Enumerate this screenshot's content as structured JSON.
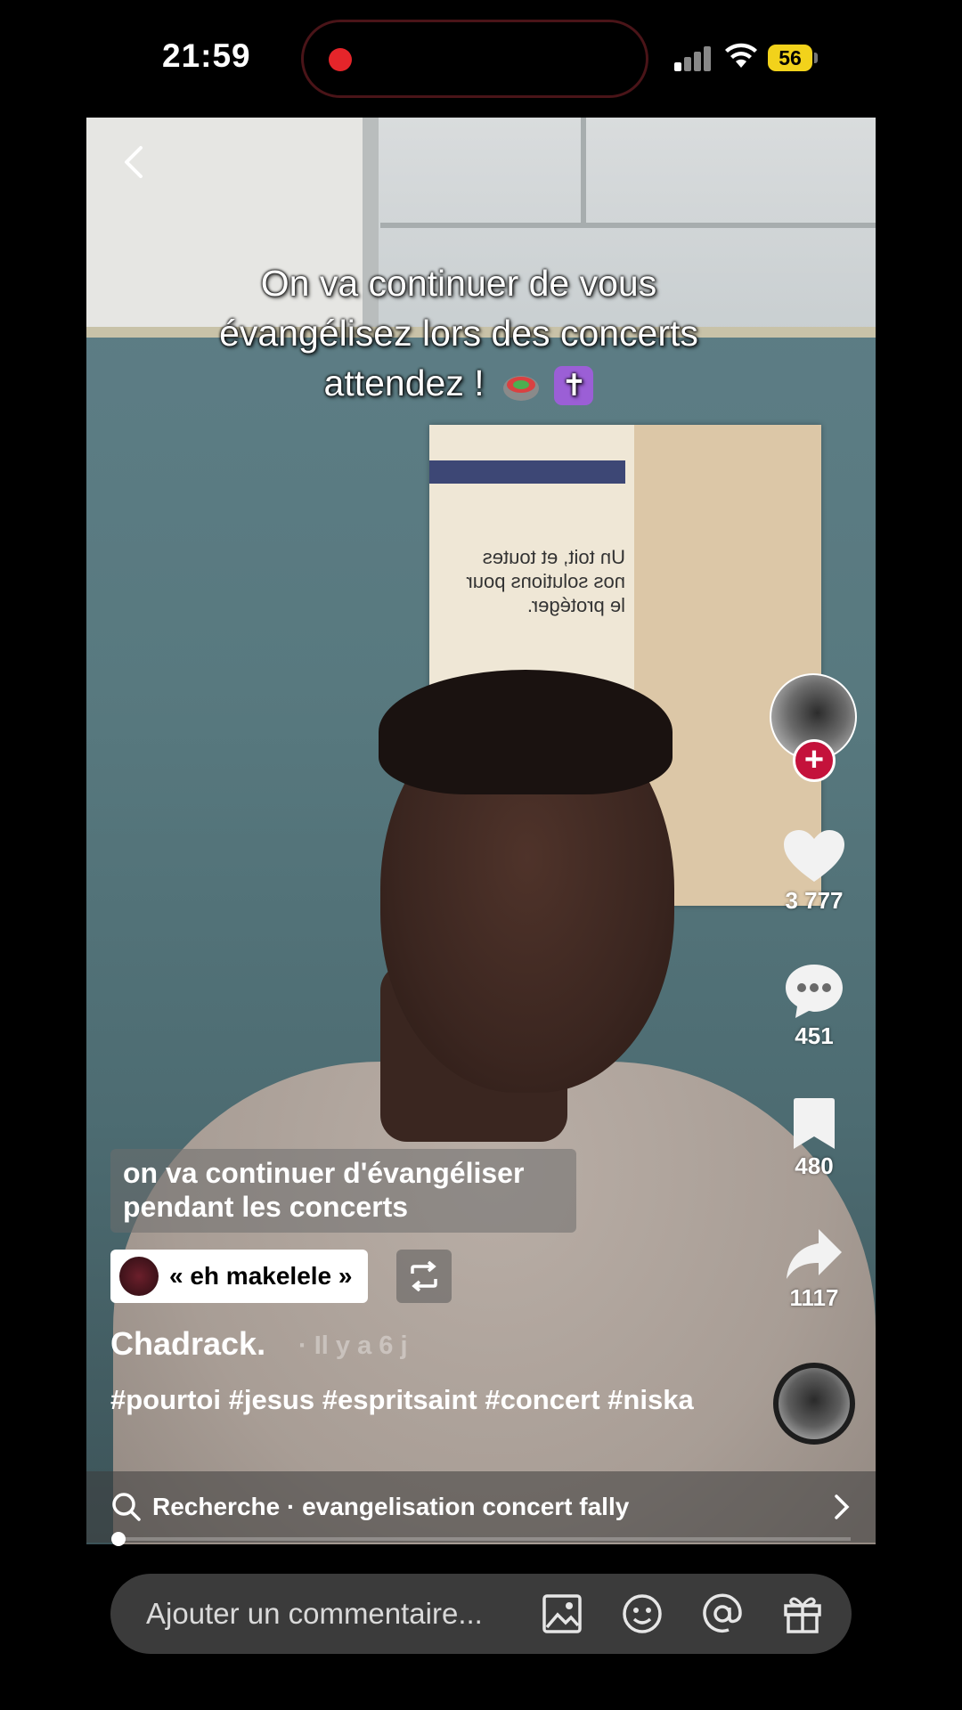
{
  "status_bar": {
    "time": "21:59",
    "battery": "56"
  },
  "video": {
    "overlay_text": "On va continuer de vous évangélisez lors des concerts attendez !",
    "overlay_emojis": [
      "stadium-emoji",
      "cross-emoji"
    ],
    "poster_text": "Un toit, et toutes nos solutions pour le protéger.",
    "subtitle": "on va continuer d'évangéliser pendant les concerts"
  },
  "sound": {
    "label": "« eh makelele »"
  },
  "author": {
    "username": "Chadrack.",
    "time_ago": "· Il y a 6 j"
  },
  "caption": {
    "hashtags": "#pourtoi #jesus #espritsaint #concert #niska"
  },
  "actions": {
    "likes": "3 777",
    "comments": "451",
    "saves": "480",
    "shares": "1117"
  },
  "search": {
    "text": "Recherche · evangelisation concert fally"
  },
  "comment_bar": {
    "placeholder": "Ajouter un commentaire..."
  },
  "icons": [
    "back-icon",
    "heart-icon",
    "comment-icon",
    "bookmark-icon",
    "share-icon",
    "repost-icon",
    "search-icon",
    "chevron-right-icon",
    "image-icon",
    "emoji-icon",
    "mention-icon",
    "gift-icon"
  ],
  "colors": {
    "follow_accent": "#c4123b",
    "battery": "#f2d21b",
    "recording_dot": "#e5252a"
  }
}
